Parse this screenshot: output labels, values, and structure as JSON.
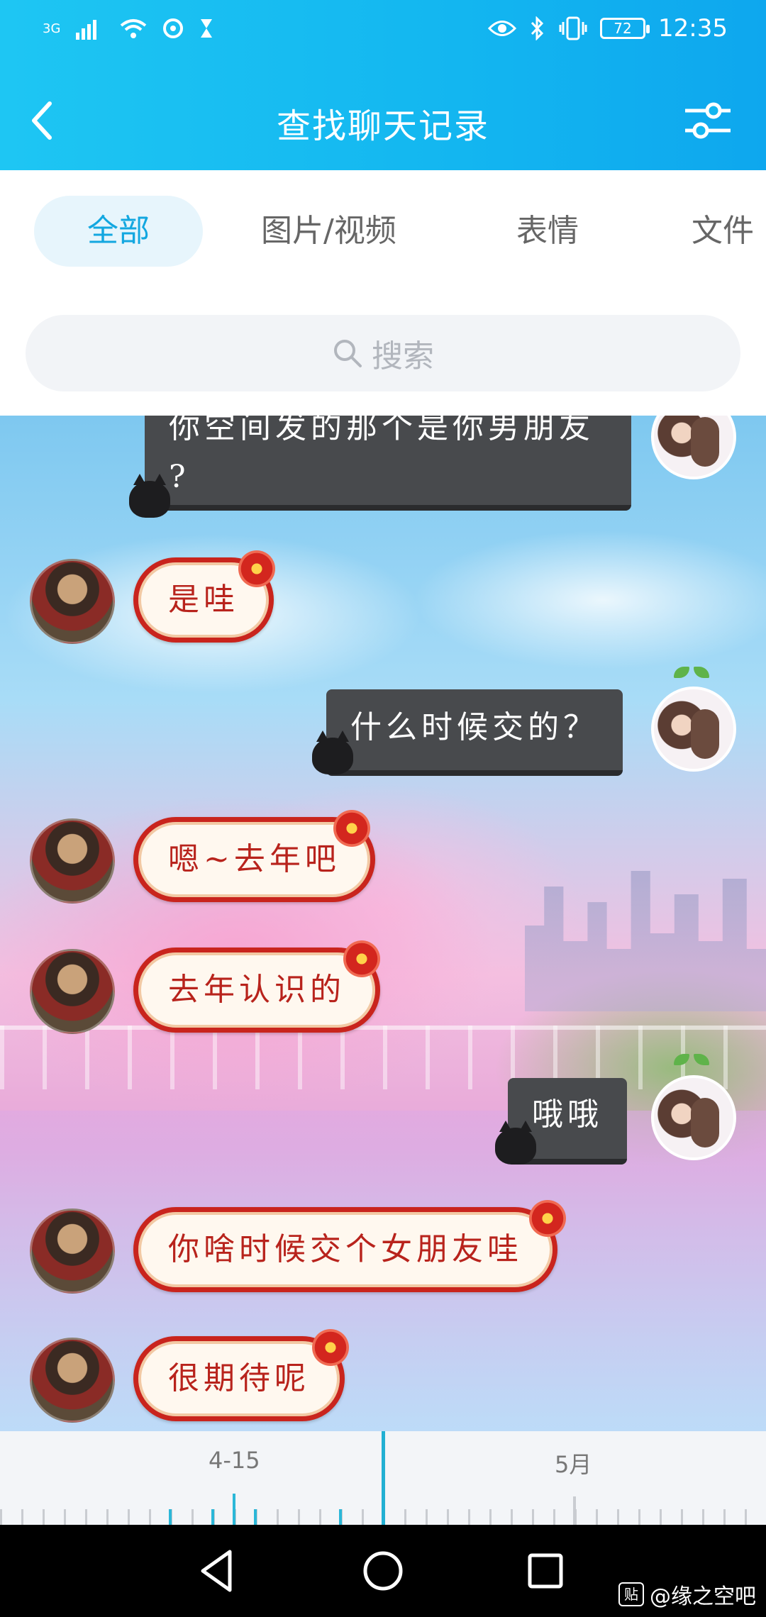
{
  "status_bar": {
    "network": "3G",
    "battery": "72",
    "time": "12:35"
  },
  "header": {
    "title": "查找聊天记录"
  },
  "tabs": [
    {
      "label": "全部",
      "active": true
    },
    {
      "label": "图片/视频",
      "active": false
    },
    {
      "label": "表情",
      "active": false
    },
    {
      "label": "文件",
      "active": false
    }
  ],
  "search": {
    "placeholder": "搜索"
  },
  "messages": [
    {
      "side": "right",
      "text_line1": "你空间发的那个是你男朋友",
      "text_line2": "?"
    },
    {
      "side": "left",
      "text": "是哇"
    },
    {
      "side": "right",
      "text": "什么时候交的？"
    },
    {
      "side": "left",
      "text": "嗯~去年吧"
    },
    {
      "side": "left",
      "text": "去年认识的"
    },
    {
      "side": "right",
      "text": "哦哦"
    },
    {
      "side": "left",
      "text": "你啥时候交个女朋友哇"
    },
    {
      "side": "left",
      "text": "很期待呢"
    }
  ],
  "timeline": {
    "label_left": "4-15",
    "label_right": "5月"
  },
  "watermark": {
    "badge": "贴",
    "text": "@缘之空吧"
  },
  "colors": {
    "header": "#13b6f0",
    "accent": "#13a7e0",
    "bubble_border": "#c9241d",
    "dark_bubble": "#484a4d"
  }
}
